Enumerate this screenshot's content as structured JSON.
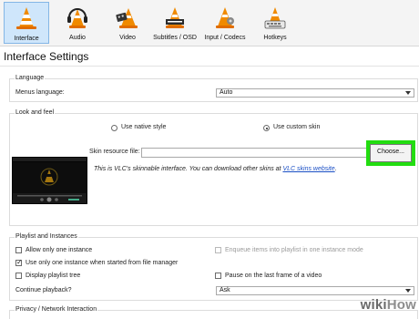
{
  "toolbar": {
    "tabs": [
      {
        "label": "Interface",
        "active": true,
        "icon": "vlc-cone-icon"
      },
      {
        "label": "Audio",
        "active": false,
        "icon": "headphones-cone-icon"
      },
      {
        "label": "Video",
        "active": false,
        "icon": "film-cone-icon"
      },
      {
        "label": "Subtitles / OSD",
        "active": false,
        "icon": "subtitles-cone-icon"
      },
      {
        "label": "Input / Codecs",
        "active": false,
        "icon": "input-cone-icon"
      },
      {
        "label": "Hotkeys",
        "active": false,
        "icon": "hotkeys-cone-icon"
      }
    ]
  },
  "header": {
    "title": "Interface Settings"
  },
  "language": {
    "group_title": "Language",
    "menus_language_label": "Menus language:",
    "menus_language_value": "Auto"
  },
  "look_and_feel": {
    "group_title": "Look and feel",
    "native_style_label": "Use native style",
    "custom_skin_label": "Use custom skin",
    "selected": "custom_skin",
    "skin_resource_label": "Skin resource file:",
    "skin_resource_value": "",
    "choose_label": "Choose...",
    "info_text": "This is VLC's skinnable interface. You can download other skins at",
    "info_link": "VLC skins website",
    "info_end": ".",
    "highlight_color": "#22dd10"
  },
  "playlist": {
    "group_title": "Playlist and Instances",
    "allow_one_instance": {
      "label": "Allow only one instance",
      "checked": false
    },
    "enqueue_items": {
      "label": "Enqueue items into playlist in one instance mode",
      "checked": false,
      "disabled": true
    },
    "one_instance_file_manager": {
      "label": "Use only one instance when started from file manager",
      "checked": true
    },
    "display_playlist_tree": {
      "label": "Display playlist tree",
      "checked": false
    },
    "pause_last_frame": {
      "label": "Pause on the last frame of a video",
      "checked": false
    },
    "continue_playback_label": "Continue playback?",
    "continue_playback_value": "Ask"
  },
  "privacy": {
    "group_title": "Privacy / Network Interaction"
  },
  "watermark": {
    "wiki": "wiki",
    "how": "How"
  }
}
